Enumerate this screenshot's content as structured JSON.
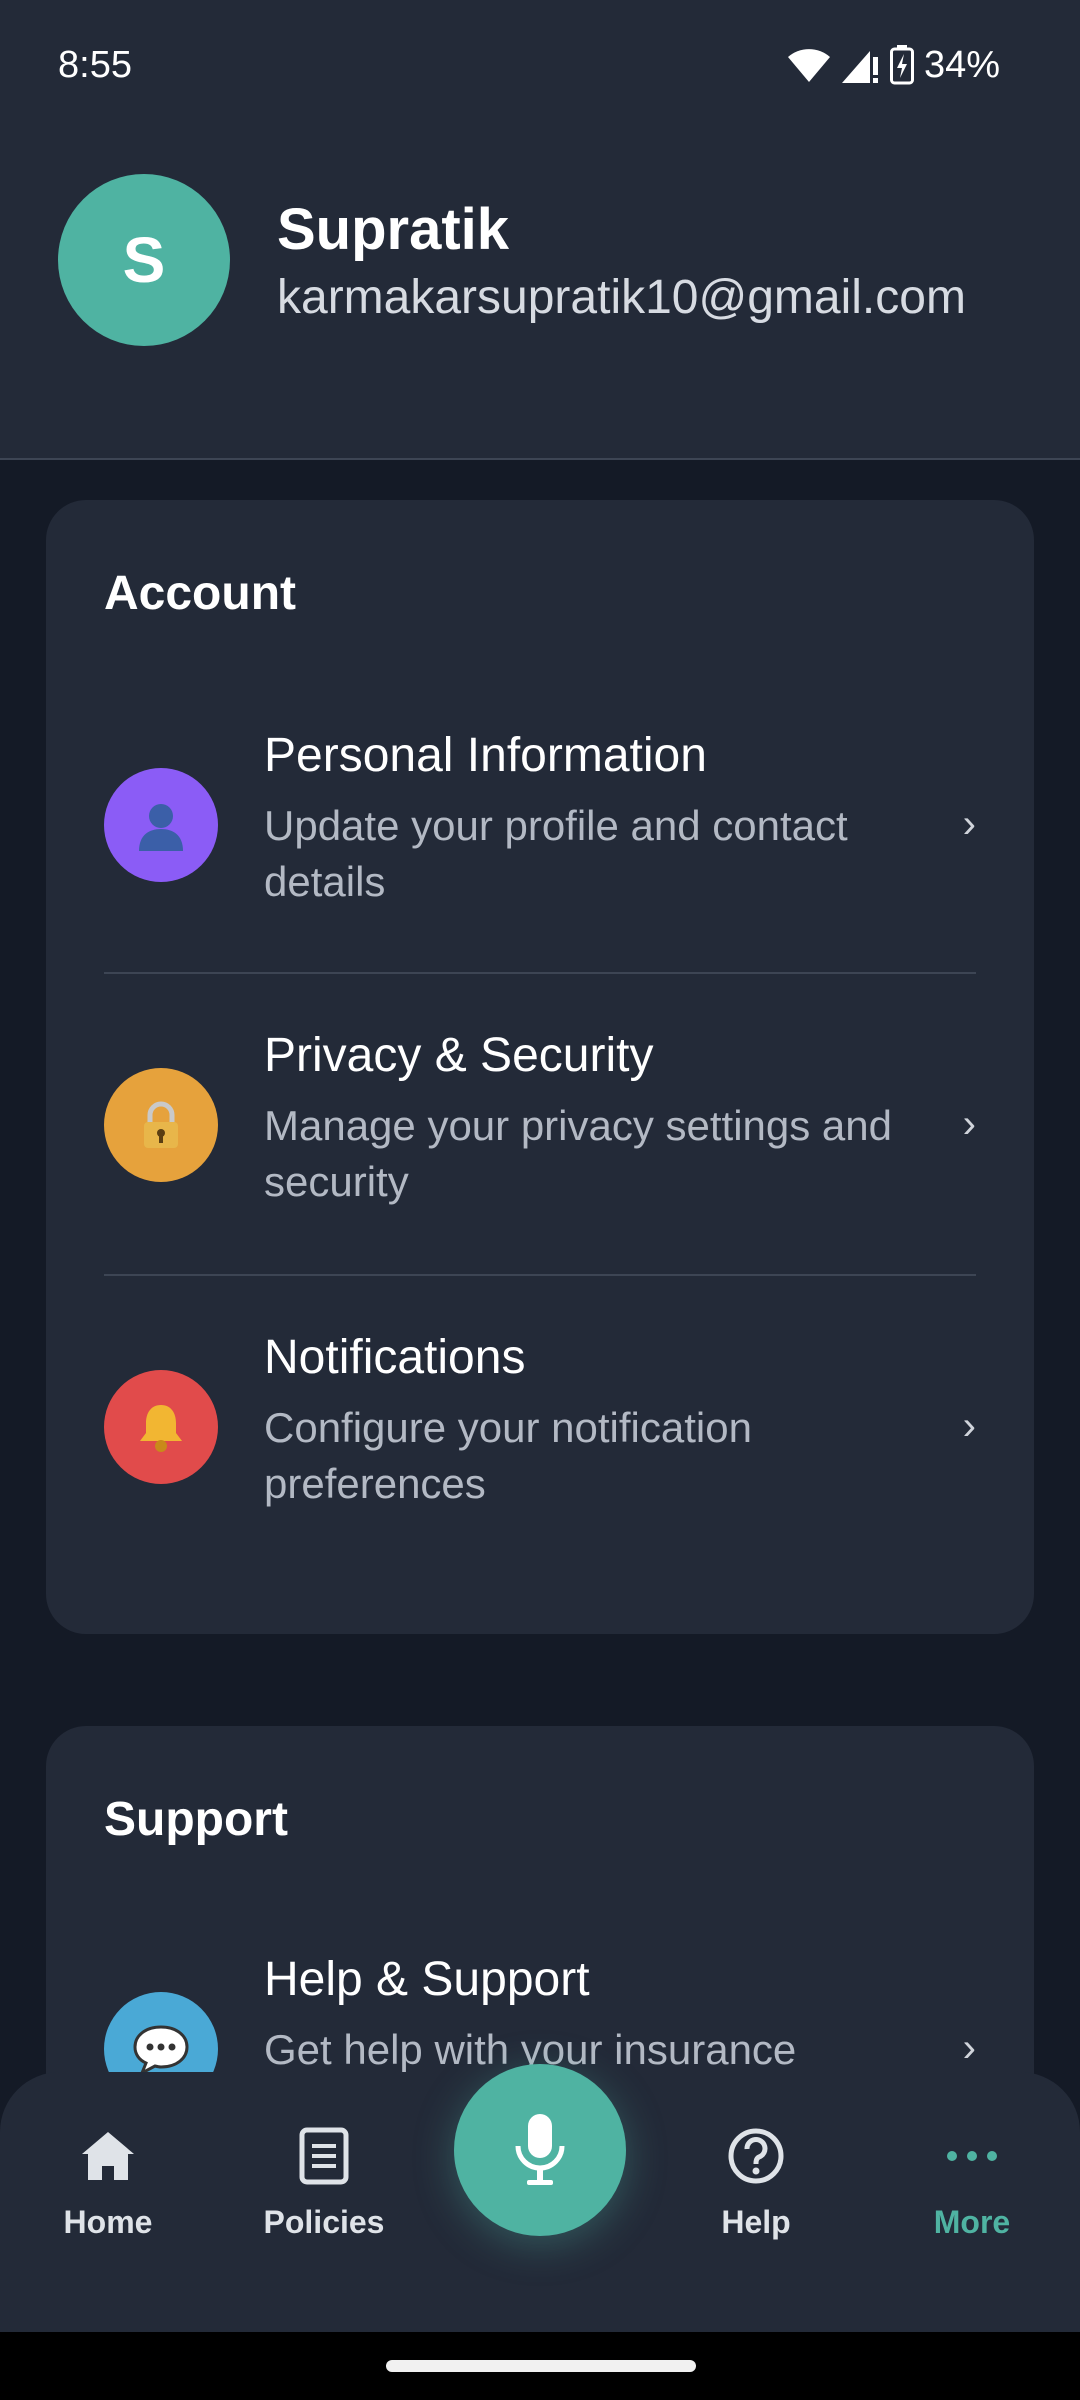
{
  "status_bar": {
    "time": "8:55",
    "battery": "34%"
  },
  "profile": {
    "initial": "S",
    "name": "Supratik",
    "email": "karmakarsupratik10@gmail.com"
  },
  "account": {
    "title": "Account",
    "items": [
      {
        "title": "Personal Information",
        "subtitle": "Update your profile and contact details",
        "icon": "person-icon",
        "color": "#8b5cf6"
      },
      {
        "title": "Privacy & Security",
        "subtitle": "Manage your privacy settings and security",
        "icon": "lock-icon",
        "color": "#e6a23c"
      },
      {
        "title": "Notifications",
        "subtitle": "Configure your notification preferences",
        "icon": "bell-icon",
        "color": "#e14b4b"
      }
    ]
  },
  "support": {
    "title": "Support",
    "items": [
      {
        "title": "Help & Support",
        "subtitle": "Get help with your insurance",
        "icon": "chat-bubble-icon",
        "color": "#4aa9d6"
      }
    ]
  },
  "chevron": "›",
  "nav": {
    "items": [
      {
        "label": "Home",
        "icon": "home-icon"
      },
      {
        "label": "Policies",
        "icon": "document-icon"
      },
      {
        "label": "Help",
        "icon": "help-circle-icon"
      },
      {
        "label": "More",
        "icon": "more-dots-icon",
        "active": true
      }
    ],
    "mic": {
      "icon": "microphone-icon",
      "color": "#4fb3a2"
    }
  },
  "colors": {
    "accent": "#4fb3a2",
    "background": "#141a26",
    "surface": "#232a38"
  }
}
